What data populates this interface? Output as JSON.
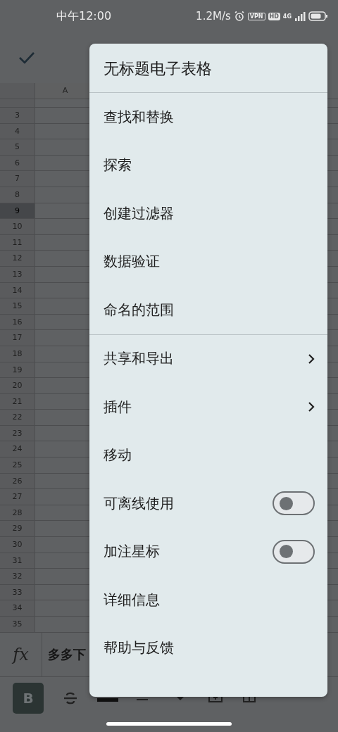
{
  "status_bar": {
    "time": "中午12:00",
    "speed": "1.2M/s",
    "vpn": "VPN",
    "hd": "HD",
    "network": "4G"
  },
  "sheet": {
    "columns": [
      {
        "label": "A"
      }
    ],
    "rows": [
      {
        "label": "3",
        "selected": false
      },
      {
        "label": "4",
        "selected": false
      },
      {
        "label": "5",
        "selected": false
      },
      {
        "label": "6",
        "selected": false
      },
      {
        "label": "7",
        "selected": false
      },
      {
        "label": "8",
        "selected": false
      },
      {
        "label": "9",
        "selected": true
      },
      {
        "label": "10",
        "selected": false
      },
      {
        "label": "11",
        "selected": false
      },
      {
        "label": "12",
        "selected": false
      },
      {
        "label": "13",
        "selected": false
      },
      {
        "label": "14",
        "selected": false
      },
      {
        "label": "15",
        "selected": false
      },
      {
        "label": "16",
        "selected": false
      },
      {
        "label": "17",
        "selected": false
      },
      {
        "label": "18",
        "selected": false
      },
      {
        "label": "19",
        "selected": false
      },
      {
        "label": "20",
        "selected": false
      },
      {
        "label": "21",
        "selected": false
      },
      {
        "label": "22",
        "selected": false
      },
      {
        "label": "23",
        "selected": false
      },
      {
        "label": "24",
        "selected": false
      },
      {
        "label": "25",
        "selected": false
      },
      {
        "label": "26",
        "selected": false
      },
      {
        "label": "27",
        "selected": false
      },
      {
        "label": "28",
        "selected": false
      },
      {
        "label": "29",
        "selected": false
      },
      {
        "label": "30",
        "selected": false
      },
      {
        "label": "31",
        "selected": false
      },
      {
        "label": "32",
        "selected": false
      },
      {
        "label": "33",
        "selected": false
      },
      {
        "label": "34",
        "selected": false
      },
      {
        "label": "35",
        "selected": false
      }
    ]
  },
  "formula_bar": {
    "label": "fx",
    "value": "多多下"
  },
  "format_toolbar": {
    "bold": {
      "label": "B",
      "selected": true
    }
  },
  "menu": {
    "title": "无标题电子表格",
    "sections": [
      {
        "items": [
          {
            "kind": "plain",
            "label": "查找和替换"
          },
          {
            "kind": "plain",
            "label": "探索"
          },
          {
            "kind": "plain",
            "label": "创建过滤器"
          },
          {
            "kind": "plain",
            "label": "数据验证"
          },
          {
            "kind": "plain",
            "label": "命名的范围"
          }
        ]
      },
      {
        "items": [
          {
            "kind": "submenu",
            "label": "共享和导出"
          },
          {
            "kind": "submenu",
            "label": "插件"
          },
          {
            "kind": "plain",
            "label": "移动"
          },
          {
            "kind": "toggle",
            "label": "可离线使用",
            "on": false
          },
          {
            "kind": "toggle",
            "label": "加注星标",
            "on": false
          },
          {
            "kind": "plain",
            "label": "详细信息"
          },
          {
            "kind": "plain",
            "label": "帮助与反馈"
          }
        ]
      }
    ]
  }
}
